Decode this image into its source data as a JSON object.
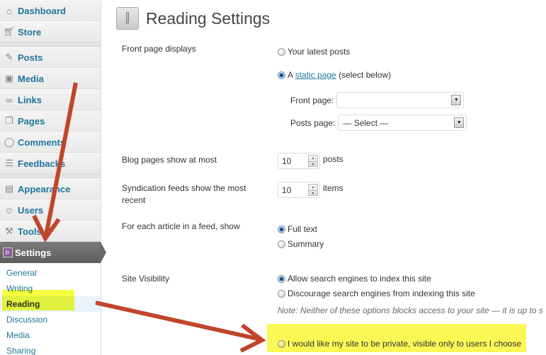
{
  "sidebar": {
    "items": [
      {
        "label": "Dashboard",
        "icon": "home-icon"
      },
      {
        "label": "Store",
        "icon": "cart-icon"
      },
      {
        "label": "Posts",
        "icon": "pushpin-icon"
      },
      {
        "label": "Media",
        "icon": "media-icon"
      },
      {
        "label": "Links",
        "icon": "link-icon"
      },
      {
        "label": "Pages",
        "icon": "pages-icon"
      },
      {
        "label": "Comments",
        "icon": "comment-icon"
      },
      {
        "label": "Feedbacks",
        "icon": "feedback-icon"
      },
      {
        "label": "Appearance",
        "icon": "appearance-icon"
      },
      {
        "label": "Users",
        "icon": "users-icon"
      },
      {
        "label": "Tools",
        "icon": "tools-icon"
      },
      {
        "label": "Settings",
        "icon": "settings-icon"
      }
    ],
    "submenu": [
      "General",
      "Writing",
      "Reading",
      "Discussion",
      "Media",
      "Sharing"
    ],
    "current_submenu": "Reading"
  },
  "page": {
    "title": "Reading Settings",
    "front_page_displays": {
      "label": "Front page displays",
      "option_latest": "Your latest posts",
      "option_static_prefix": "A ",
      "option_static_link": "static page",
      "option_static_suffix": " (select below)",
      "selected": "static",
      "front_page_label": "Front page:",
      "front_page_value": "",
      "posts_page_label": "Posts page:",
      "posts_page_value": "— Select —"
    },
    "blog_pages": {
      "label": "Blog pages show at most",
      "value": "10",
      "unit": "posts"
    },
    "syndication": {
      "label": "Syndication feeds show the most recent",
      "value": "10",
      "unit": "items"
    },
    "feed_article": {
      "label": "For each article in a feed, show",
      "options": [
        "Full text",
        "Summary"
      ],
      "selected": "Full text"
    },
    "site_visibility": {
      "label": "Site Visibility",
      "options": [
        "Allow search engines to index this site",
        "Discourage search engines from indexing this site"
      ],
      "selected": "Allow search engines to index this site",
      "note": "Note: Neither of these options blocks access to your site — it is up to s",
      "private_option": "I would like my site to be private, visible only to users I choose"
    }
  },
  "annotations": {
    "highlight_color": "#faf855",
    "arrow_color": "#c0452b"
  }
}
